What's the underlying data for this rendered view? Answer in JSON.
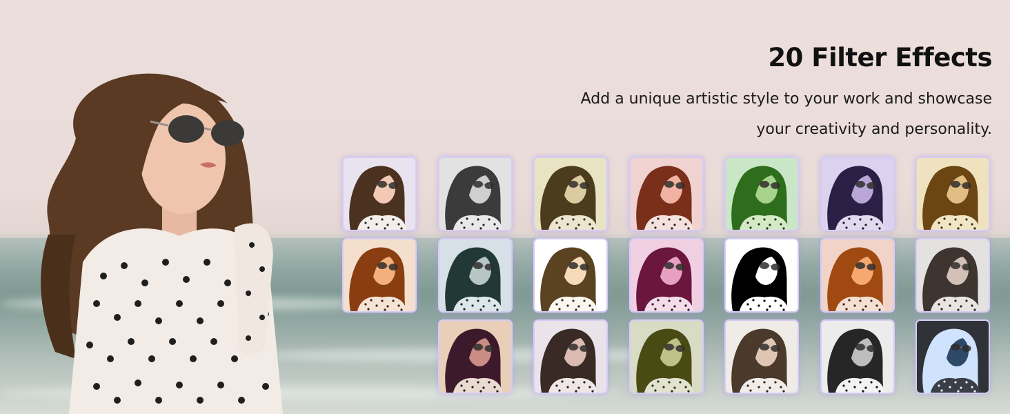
{
  "headline": "20 Filter Effects",
  "description": {
    "line1": "Add a unique artistic style to your work and showcase",
    "line2": "your creativity and personality."
  },
  "filters": [
    {
      "id": "original",
      "bg": "#e9e2ef",
      "hair": "#4b3220",
      "skin": "#f1c9b4",
      "top": "#f3eee9",
      "dot": "#2a2a2a"
    },
    {
      "id": "mono",
      "bg": "#e2e2e2",
      "hair": "#3b3b3b",
      "skin": "#cfcfcf",
      "top": "#e8e8e8",
      "dot": "#222222"
    },
    {
      "id": "sepia-soft",
      "bg": "#e8e4c3",
      "hair": "#4c3c1e",
      "skin": "#dccaa1",
      "top": "#ece5cf",
      "dot": "#33301f"
    },
    {
      "id": "rose-warm",
      "bg": "#f0d2d1",
      "hair": "#7a2f1b",
      "skin": "#f0b2a3",
      "top": "#f2e1dc",
      "dot": "#3a1d17"
    },
    {
      "id": "green-tint",
      "bg": "#c9e6c7",
      "hair": "#2e6d1c",
      "skin": "#a6d28b",
      "top": "#d4eac7",
      "dot": "#1b3a12"
    },
    {
      "id": "violet-tint",
      "bg": "#dcd2ef",
      "hair": "#2b1f45",
      "skin": "#b9a6d6",
      "top": "#e1d9ee",
      "dot": "#1e1733"
    },
    {
      "id": "golden",
      "bg": "#efe3bf",
      "hair": "#6b4512",
      "skin": "#e1be83",
      "top": "#f0e6c6",
      "dot": "#3a2a0e"
    },
    {
      "id": "amber",
      "bg": "#f4dfcc",
      "hair": "#8a3d10",
      "skin": "#f3b07c",
      "top": "#f4e4d6",
      "dot": "#3d1c0b"
    },
    {
      "id": "teal-cool",
      "bg": "#d7e0e6",
      "hair": "#213836",
      "skin": "#b7c6c5",
      "top": "#dde6e8",
      "dot": "#182624"
    },
    {
      "id": "bright",
      "bg": "#ffffff",
      "hair": "#5b4322",
      "skin": "#f7dbb9",
      "top": "#fbf6ef",
      "dot": "#2e2a22"
    },
    {
      "id": "magenta",
      "bg": "#f1cfe2",
      "hair": "#6a163d",
      "skin": "#e7a0bf",
      "top": "#f2dde9",
      "dot": "#3a0f24"
    },
    {
      "id": "threshold",
      "bg": "#ffffff",
      "hair": "#000000",
      "skin": "#ffffff",
      "top": "#ffffff",
      "dot": "#000000"
    },
    {
      "id": "orange-pop",
      "bg": "#f2d3c8",
      "hair": "#a04a12",
      "skin": "#f6a870",
      "top": "#f3e0d3",
      "dot": "#41200b"
    },
    {
      "id": "faded",
      "bg": "#e4e1e1",
      "hair": "#3e3430",
      "skin": "#d3c1b7",
      "top": "#e8e4e1",
      "dot": "#2a2422"
    },
    {
      "id": "dusk",
      "bg": "#e9cfb8",
      "hair": "#3c1a2b",
      "skin": "#c98d86",
      "top": "#eadbd0",
      "dot": "#2a1420"
    },
    {
      "id": "cool-rose",
      "bg": "#ebe3ea",
      "hair": "#3a2a26",
      "skin": "#dcbcb2",
      "top": "#efe7e6",
      "dot": "#281d1a"
    },
    {
      "id": "olive",
      "bg": "#d9dcc5",
      "hair": "#4a4a14",
      "skin": "#bfc08a",
      "top": "#e2e3cf",
      "dot": "#2d2d0e"
    },
    {
      "id": "muted-warm",
      "bg": "#efebe6",
      "hair": "#4b392c",
      "skin": "#dfc6b4",
      "top": "#f1ece7",
      "dot": "#2c241d"
    },
    {
      "id": "high-contrast",
      "bg": "#ececec",
      "hair": "#262626",
      "skin": "#bdbdbd",
      "top": "#f3f3f3",
      "dot": "#111111"
    },
    {
      "id": "negative",
      "bg": "#2f3338",
      "hair": "#cfe3ff",
      "skin": "#2e4868",
      "top": "#3a3f46",
      "dot": "#e8f1ff"
    }
  ]
}
